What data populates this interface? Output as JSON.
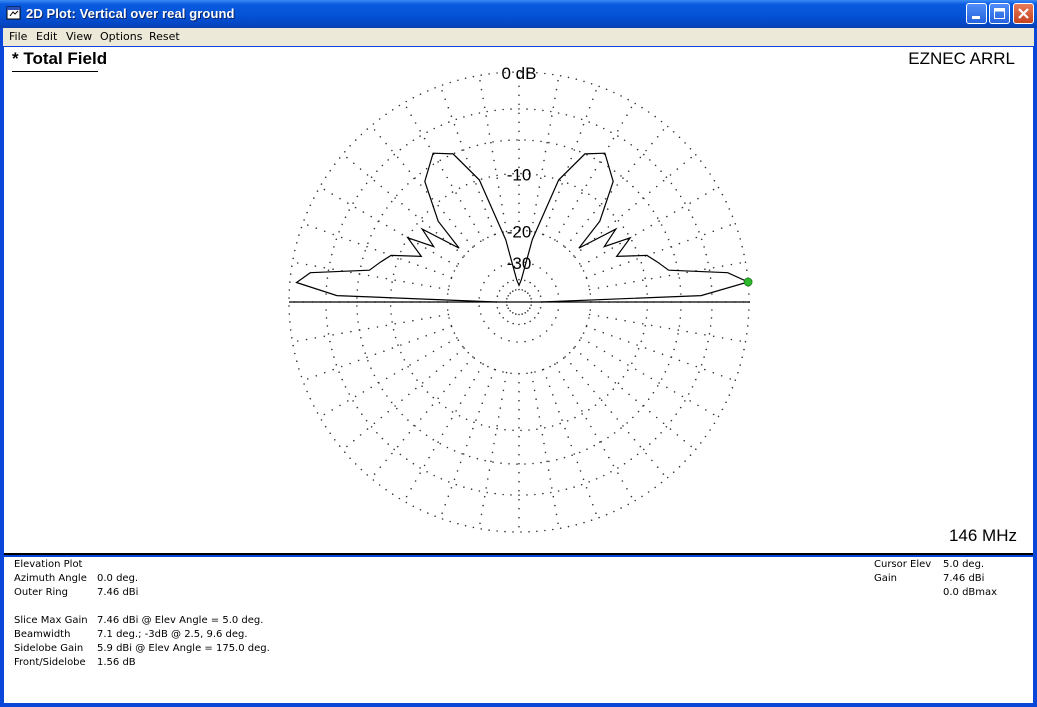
{
  "window": {
    "title": "2D Plot: Vertical over real ground"
  },
  "menu": {
    "items": [
      "File",
      "Edit",
      "View",
      "Options",
      "Reset"
    ]
  },
  "plot": {
    "title": "* Total Field",
    "brand": "EZNEC ARRL",
    "frequency": "146 MHz",
    "ring_labels": [
      "0 dB",
      "-10",
      "-20",
      "-30"
    ],
    "pattern_color": "#000000",
    "cursor_color": "#2eb82e"
  },
  "chart_data": {
    "type": "polar",
    "plot_kind": "Elevation Plot",
    "rings_db": [
      0,
      -10,
      -20,
      -30
    ],
    "outer_ring_dbi": 7.46,
    "angle_unit": "deg",
    "pattern": [
      {
        "elev": 0,
        "db": -40
      },
      {
        "elev": 2,
        "db": -4
      },
      {
        "elev": 5,
        "db": 0
      },
      {
        "elev": 8,
        "db": -1.5
      },
      {
        "elev": 12,
        "db": -7
      },
      {
        "elev": 16,
        "db": -8
      },
      {
        "elev": 20,
        "db": -9
      },
      {
        "elev": 25,
        "db": -13
      },
      {
        "elev": 30,
        "db": -10
      },
      {
        "elev": 33,
        "db": -14
      },
      {
        "elev": 37,
        "db": -11
      },
      {
        "elev": 42,
        "db": -18
      },
      {
        "elev": 45,
        "db": -12
      },
      {
        "elev": 52,
        "db": -7
      },
      {
        "elev": 60,
        "db": -5
      },
      {
        "elev": 66,
        "db": -6
      },
      {
        "elev": 72,
        "db": -10
      },
      {
        "elev": 78,
        "db": -22
      },
      {
        "elev": 84,
        "db": -40
      },
      {
        "elev": 90,
        "db": -45
      },
      {
        "elev": 96,
        "db": -40
      },
      {
        "elev": 102,
        "db": -22
      },
      {
        "elev": 108,
        "db": -10
      },
      {
        "elev": 114,
        "db": -6
      },
      {
        "elev": 120,
        "db": -5
      },
      {
        "elev": 128,
        "db": -7
      },
      {
        "elev": 135,
        "db": -12
      },
      {
        "elev": 138,
        "db": -18
      },
      {
        "elev": 143,
        "db": -11
      },
      {
        "elev": 147,
        "db": -14
      },
      {
        "elev": 150,
        "db": -10
      },
      {
        "elev": 155,
        "db": -13
      },
      {
        "elev": 160,
        "db": -9
      },
      {
        "elev": 164,
        "db": -8
      },
      {
        "elev": 168,
        "db": -7
      },
      {
        "elev": 172,
        "db": -1.5
      },
      {
        "elev": 175,
        "db": -0.5
      },
      {
        "elev": 178,
        "db": -4
      },
      {
        "elev": 180,
        "db": -40
      }
    ],
    "cursor": {
      "elev": 5.0,
      "db": 0
    }
  },
  "info": {
    "plot_type": "Elevation Plot",
    "left_rows": [
      {
        "label": "Azimuth Angle",
        "value": "0.0 deg."
      },
      {
        "label": "Outer Ring",
        "value": "7.46 dBi"
      }
    ],
    "stats_rows": [
      {
        "label": "Slice Max Gain",
        "value": "7.46 dBi @ Elev Angle = 5.0 deg."
      },
      {
        "label": "Beamwidth",
        "value": "7.1 deg.; -3dB @ 2.5, 9.6 deg."
      },
      {
        "label": "Sidelobe Gain",
        "value": "5.9 dBi @ Elev Angle = 175.0 deg."
      },
      {
        "label": "Front/Sidelobe",
        "value": "1.56 dB"
      }
    ],
    "cursor_rows": [
      {
        "label": "Cursor Elev",
        "value": "5.0 deg."
      },
      {
        "label": "Gain",
        "value": "7.46 dBi"
      },
      {
        "label": "",
        "value": "0.0 dBmax"
      }
    ]
  }
}
